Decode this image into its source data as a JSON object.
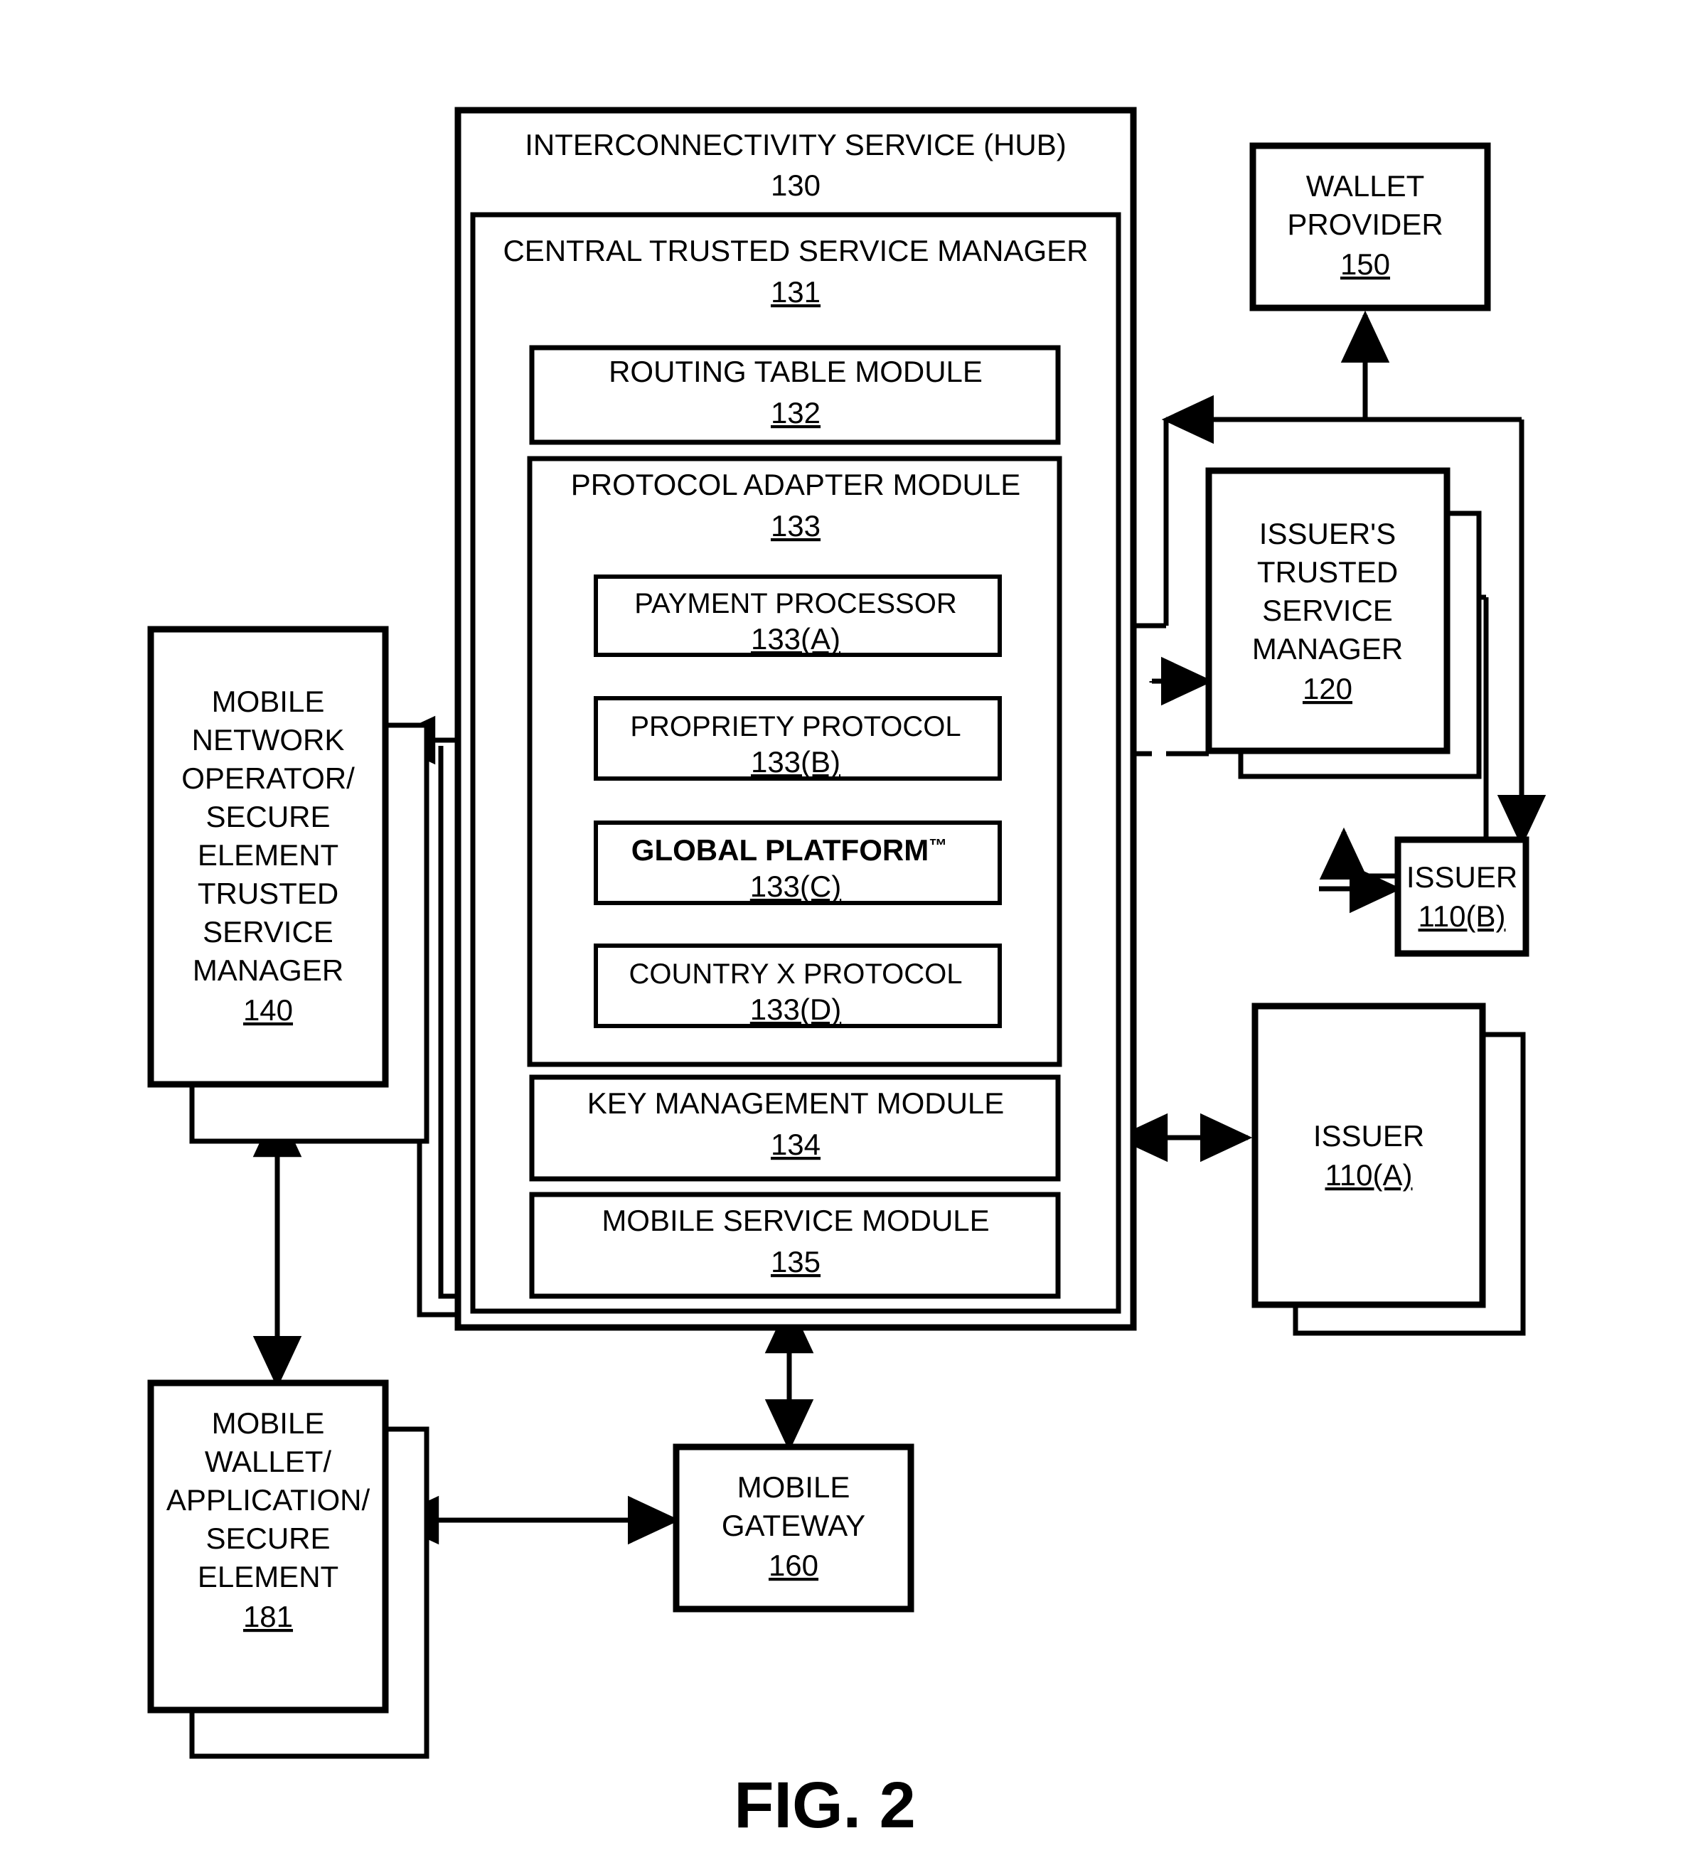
{
  "figure": {
    "caption": "FIG. 2"
  },
  "hub": {
    "title": "INTERCONNECTIVITY SERVICE (HUB)",
    "ref": "130"
  },
  "ctsm": {
    "title": "CENTRAL TRUSTED SERVICE MANAGER",
    "ref": "131"
  },
  "routing_table": {
    "title": "ROUTING TABLE MODULE",
    "ref": "132"
  },
  "protocol_adapter": {
    "title": "PROTOCOL ADAPTER MODULE",
    "ref": "133",
    "adapters": [
      {
        "title": "PAYMENT PROCESSOR",
        "ref": "133(A)",
        "bold": false
      },
      {
        "title": "PROPRIETY PROTOCOL",
        "ref": "133(B)",
        "bold": false
      },
      {
        "title": "GLOBAL PLATFORM",
        "trademark": "™",
        "ref": "133(C)",
        "bold": true
      },
      {
        "title": "COUNTRY X PROTOCOL",
        "ref": "133(D)",
        "bold": false
      }
    ]
  },
  "key_management": {
    "title": "KEY MANAGEMENT MODULE",
    "ref": "134"
  },
  "mobile_service": {
    "title": "MOBILE SERVICE MODULE",
    "ref": "135"
  },
  "wallet_provider": {
    "lines": [
      "WALLET",
      "PROVIDER"
    ],
    "ref": "150"
  },
  "issuers_tsm": {
    "lines": [
      "ISSUER'S",
      "TRUSTED",
      "SERVICE",
      "MANAGER"
    ],
    "ref": "120"
  },
  "issuer_b": {
    "lines": [
      "ISSUER"
    ],
    "ref": "110(B)"
  },
  "issuer_a": {
    "lines": [
      "ISSUER"
    ],
    "ref": "110(A)"
  },
  "mno_tsm": {
    "lines": [
      "MOBILE",
      "NETWORK",
      "OPERATOR/",
      "SECURE",
      "ELEMENT",
      "TRUSTED",
      "SERVICE",
      "MANAGER"
    ],
    "ref": "140"
  },
  "mobile_wallet": {
    "lines": [
      "MOBILE",
      "WALLET/",
      "APPLICATION/",
      "SECURE",
      "ELEMENT"
    ],
    "ref": "181"
  },
  "mobile_gateway": {
    "lines": [
      "MOBILE",
      "GATEWAY"
    ],
    "ref": "160"
  },
  "colors": {
    "stroke": "#000000",
    "background": "#ffffff"
  }
}
